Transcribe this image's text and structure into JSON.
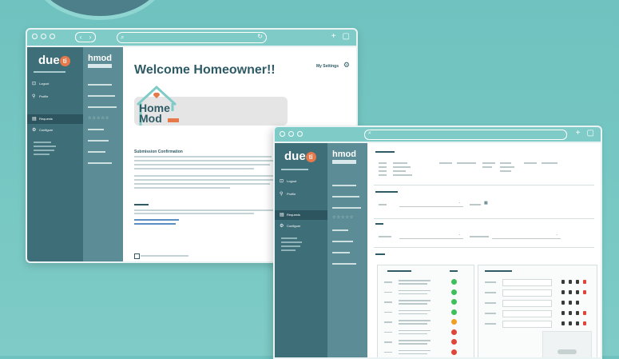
{
  "window1": {
    "sidebar": {
      "logo": "due",
      "items": [
        {
          "label": "Logout",
          "icon": "logout-icon"
        },
        {
          "label": "Profile",
          "icon": "profile-icon"
        },
        {
          "label": "Requests",
          "icon": "requests-icon"
        },
        {
          "label": "Configure",
          "icon": "configure-icon"
        }
      ]
    },
    "secondary_sidebar": {
      "logo": "hmod"
    },
    "main": {
      "title": "Welcome Homeowner!!",
      "settings_label": "My Settings",
      "brand_home": "Home",
      "brand_mod": "Mod",
      "section_title": "Submission Confirmation"
    }
  },
  "window2": {
    "sidebar": {
      "logo": "due",
      "items": [
        {
          "label": "Logout",
          "icon": "logout-icon"
        },
        {
          "label": "Profile",
          "icon": "profile-icon"
        },
        {
          "label": "Requests",
          "icon": "requests-icon"
        },
        {
          "label": "Configure",
          "icon": "configure-icon"
        }
      ]
    },
    "secondary_sidebar": {
      "logo": "hmod"
    },
    "status_colors": [
      "#3fbf5a",
      "#3fbf5a",
      "#3fbf5a",
      "#3fbf5a",
      "#f0a020",
      "#e0453a",
      "#e0453a",
      "#e0453a"
    ],
    "colors": {
      "teal_dark": "#3e6e78",
      "teal_mid": "#5c8c95",
      "accent_orange": "#e6784a",
      "background": "#78c8c4"
    }
  }
}
